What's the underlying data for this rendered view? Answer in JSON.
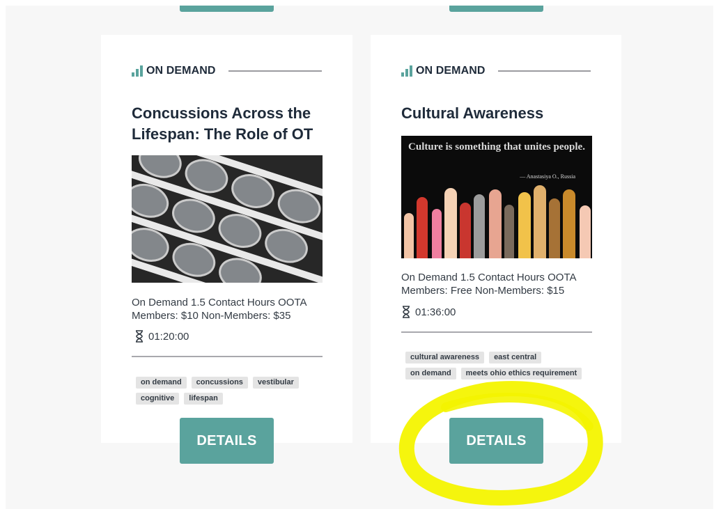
{
  "cards": [
    {
      "badge": "ON DEMAND",
      "title": "Concussions Across the Lifespan: The Role of OT",
      "description": "On Demand 1.5 Contact Hours OOTA Members: $10 Non-Members: $35",
      "duration": "01:20:00",
      "tags": [
        "on demand",
        "concussions",
        "vestibular",
        "cognitive",
        "lifespan"
      ],
      "button": "DETAILS"
    },
    {
      "badge": "ON DEMAND",
      "title": "Cultural Awareness",
      "image_quote": "Culture is something that unites people.",
      "image_attribution": "— Anastasiya O., Russia",
      "description": "On Demand 1.5 Contact Hours OOTA Members: Free Non-Members: $15",
      "duration": "01:36:00",
      "tags": [
        "cultural awareness",
        "east central",
        "on demand",
        "meets ohio ethics requirement"
      ],
      "button": "DETAILS"
    }
  ],
  "colors": {
    "accent": "#5aa39d",
    "title_text": "#1f2b3a",
    "highlight": "#f4f400"
  }
}
